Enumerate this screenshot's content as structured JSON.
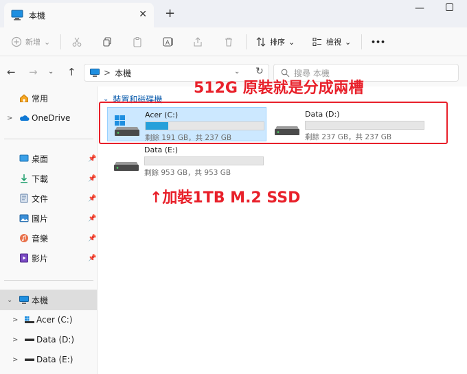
{
  "window": {
    "tab_title": "本機",
    "tab_close": "✕",
    "new_tab": "+",
    "minimize": "—"
  },
  "toolbar": {
    "new_label": "新增",
    "sort_label": "排序",
    "view_label": "檢視",
    "more_label": "•••",
    "dropdown_chevron": "⌄"
  },
  "address": {
    "path": "本機",
    "separator": ">",
    "search_placeholder": "搜尋 本機"
  },
  "sidebar": {
    "home": "常用",
    "onedrive": "OneDrive",
    "quick": [
      "桌面",
      "下載",
      "文件",
      "圖片",
      "音樂",
      "影片"
    ],
    "this_pc": "本機",
    "drives": [
      "Acer (C:)",
      "Data (D:)",
      "Data (E:)"
    ]
  },
  "content": {
    "group_header": "裝置和磁碟機",
    "drives": [
      {
        "name": "Acer (C:)",
        "info": "剩餘 191 GB，共 237 GB",
        "used_fraction": 0.19
      },
      {
        "name": "Data (D:)",
        "info": "剩餘 237 GB，共 237 GB",
        "used_fraction": 0.0
      },
      {
        "name": "Data (E:)",
        "info": "剩餘 953 GB，共 953 GB",
        "used_fraction": 0.0
      }
    ]
  },
  "annotations": {
    "top": "512G 原裝就是分成兩槽",
    "bottom": "↑加裝1TB M.2 SSD",
    "color": "#e8202a"
  },
  "colors": {
    "accent": "#26a0da",
    "selection": "#cce8ff",
    "link": "#0b5cad"
  }
}
